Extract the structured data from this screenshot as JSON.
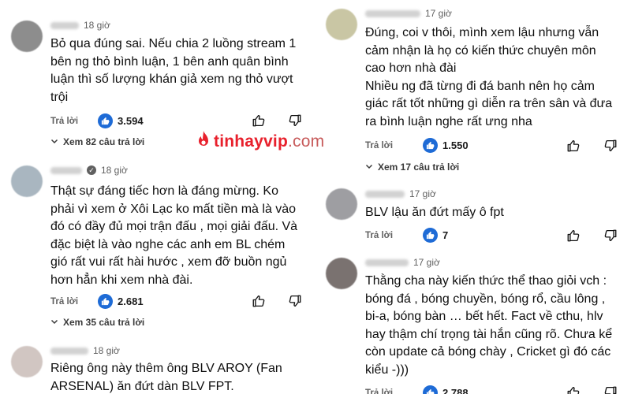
{
  "watermark": {
    "brand": "tinhayvip",
    "domain": ".com",
    "color": "#e8202c"
  },
  "reply_label": "Trả lời",
  "left_column": [
    {
      "time": "18 giờ",
      "lines": [
        "Bỏ qua đúng sai. Nếu chia 2 luồng stream 1",
        "bên ng thỏ bình luận, 1 bên anh quân bình",
        "luận thì số lượng khán giả xem ng thỏ vượt",
        "trội"
      ],
      "likes": "3.594",
      "view_replies": "Xem 82 câu trả lời"
    },
    {
      "time": "18 giờ",
      "verified": true,
      "lines": [
        "Thật sự đáng tiếc hơn là đáng mừng. Ko",
        "phải vì xem ở Xôi Lạc ko mất tiền mà là vào",
        "đó có đầy đủ mọi trận đấu , mọi giải đấu. Và",
        "đặc biệt là vào nghe các anh em BL chém",
        "gió rất vui rất hài hước , xem đỡ buồn ngủ",
        "hơn hẳn khi xem nhà đài."
      ],
      "likes": "2.681",
      "view_replies": "Xem 35 câu trả lời"
    },
    {
      "time": "18 giờ",
      "lines": [
        "Riêng ông này thêm ông BLV AROY (Fan",
        "ARSENAL) ăn đứt dàn BLV FPT."
      ]
    }
  ],
  "right_column": [
    {
      "time": "17 giờ",
      "lines": [
        "Đúng, coi v thôi, mình xem lậu nhưng vẫn",
        "cảm nhận là họ có kiến thức chuyên môn",
        "cao hơn nhà đài",
        "Nhiều ng đã từng đi đá banh nên họ cảm",
        "giác rất tốt những gì diễn ra trên sân và đưa",
        "ra bình luận nghe rất ưng nha"
      ],
      "likes": "1.550",
      "view_replies": "Xem 17 câu trả lời"
    },
    {
      "time": "17 giờ",
      "lines": [
        "BLV lậu ăn đứt mấy ô fpt"
      ],
      "likes": "7"
    },
    {
      "time": "17 giờ",
      "lines": [
        "Thằng cha này kiến thức thể thao giỏi vch :",
        "bóng đá , bóng chuyền, bóng rổ, cầu lông ,",
        "bi-a, bóng bàn … bết hết. Fact về cthu, hlv",
        "hay thậm chí trọng tài hắn cũng rõ. Chưa kể",
        "còn update cả bóng chày , Cricket gì đó các",
        "kiểu -)))"
      ],
      "likes": "2.788"
    }
  ]
}
